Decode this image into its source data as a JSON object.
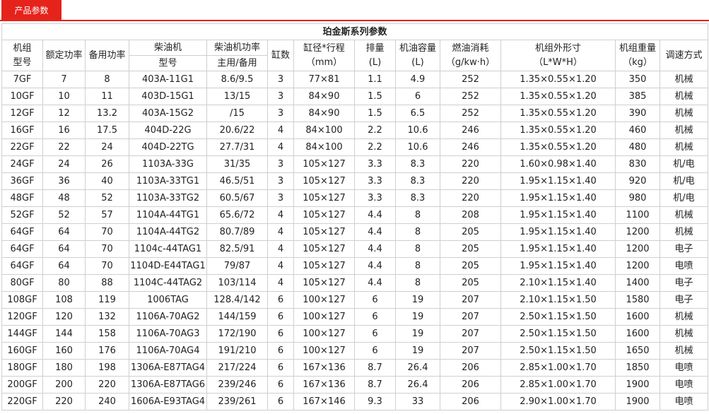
{
  "tab": {
    "label": "产品参数"
  },
  "table": {
    "title": "珀金斯系列参数",
    "headers": {
      "model_l1": "机组",
      "model_l2": "型号",
      "rated_power": "额定功率",
      "standby_power": "备用功率",
      "engine_l1": "柴油机",
      "engine_l2": "型号",
      "engine_power_l1": "柴油机功率",
      "engine_power_l2": "主用/备用",
      "cylinders": "缸数",
      "bore_l1": "缸径*行程",
      "bore_l2": "（mm）",
      "displacement_l1": "排量",
      "displacement_l2": "(L)",
      "oil_l1": "机油容量",
      "oil_l2": "(L)",
      "fuel_l1": "燃油消耗",
      "fuel_l2": "（g/kw·h）",
      "dims_l1": "机组外形寸",
      "dims_l2": "（L*W*H）",
      "weight_l1": "机组重量",
      "weight_l2": "（kg）",
      "governor": "调速方式"
    },
    "rows": [
      [
        "7GF",
        "7",
        "8",
        "403A-11G1",
        "8.6/9.5",
        "3",
        "77×81",
        "1.1",
        "4.9",
        "252",
        "1.35×0.55×1.20",
        "350",
        "机械"
      ],
      [
        "10GF",
        "10",
        "11",
        "403D-15G1",
        "13/15",
        "3",
        "84×90",
        "1.5",
        "6",
        "252",
        "1.35×0.55×1.20",
        "385",
        "机械"
      ],
      [
        "12GF",
        "12",
        "13.2",
        "403A-15G2",
        "/15",
        "3",
        "84×90",
        "1.5",
        "6.5",
        "252",
        "1.35×0.55×1.20",
        "390",
        "机械"
      ],
      [
        "16GF",
        "16",
        "17.5",
        "404D-22G",
        "20.6/22",
        "4",
        "84×100",
        "2.2",
        "10.6",
        "246",
        "1.35×0.55×1.20",
        "460",
        "机械"
      ],
      [
        "22GF",
        "22",
        "24",
        "404D-22TG",
        "27.7/31",
        "4",
        "84×100",
        "2.2",
        "10.6",
        "246",
        "1.35×0.55×1.20",
        "480",
        "机械"
      ],
      [
        "24GF",
        "24",
        "26",
        "1103A-33G",
        "31/35",
        "3",
        "105×127",
        "3.3",
        "8.3",
        "220",
        "1.60×0.98×1.40",
        "830",
        "机/电"
      ],
      [
        "36GF",
        "36",
        "40",
        "1103A-33TG1",
        "46.5/51",
        "3",
        "105×127",
        "3.3",
        "8.3",
        "220",
        "1.95×1.15×1.40",
        "920",
        "机/电"
      ],
      [
        "48GF",
        "48",
        "52",
        "1103A-33TG2",
        "60.5/67",
        "3",
        "105×127",
        "3.3",
        "8.3",
        "220",
        "1.95×1.15×1.40",
        "980",
        "机/电"
      ],
      [
        "52GF",
        "52",
        "57",
        "1104A-44TG1",
        "65.6/72",
        "4",
        "105×127",
        "4.4",
        "8",
        "208",
        "1.95×1.15×1.40",
        "1100",
        "机械"
      ],
      [
        "64GF",
        "64",
        "70",
        "1104A-44TG2",
        "80.7/89",
        "4",
        "105×127",
        "4.4",
        "8",
        "205",
        "1.95×1.15×1.40",
        "1200",
        "机械"
      ],
      [
        "64GF",
        "64",
        "70",
        "1104c-44TAG1",
        "82.5/91",
        "4",
        "105×127",
        "4.4",
        "8",
        "205",
        "1.95×1.15×1.40",
        "1200",
        "电子"
      ],
      [
        "64GF",
        "64",
        "70",
        "1104D-E44TAG1",
        "79/87",
        "4",
        "105×127",
        "4.4",
        "8",
        "205",
        "1.95×1.15×1.40",
        "1200",
        "电喷"
      ],
      [
        "80GF",
        "80",
        "88",
        "1104C-44TAG2",
        "103/114",
        "4",
        "105×127",
        "4.4",
        "8",
        "205",
        "2.10×1.15×1.40",
        "1400",
        "电子"
      ],
      [
        "108GF",
        "108",
        "119",
        "1006TAG",
        "128.4/142",
        "6",
        "100×127",
        "6",
        "19",
        "207",
        "2.10×1.15×1.50",
        "1580",
        "电子"
      ],
      [
        "120GF",
        "120",
        "132",
        "1106A-70AG2",
        "144/159",
        "6",
        "100×127",
        "6",
        "19",
        "207",
        "2.50×1.15×1.50",
        "1600",
        "机械"
      ],
      [
        "144GF",
        "144",
        "158",
        "1106A-70AG3",
        "172/190",
        "6",
        "100×127",
        "6",
        "19",
        "207",
        "2.50×1.15×1.50",
        "1600",
        "机械"
      ],
      [
        "160GF",
        "160",
        "176",
        "1106A-70AG4",
        "191/210",
        "6",
        "100×127",
        "6",
        "19",
        "207",
        "2.50×1.15×1.50",
        "1650",
        "机械"
      ],
      [
        "180GF",
        "180",
        "198",
        "1306A-E87TAG4",
        "217/224",
        "6",
        "167×136",
        "8.7",
        "26.4",
        "206",
        "2.85×1.00×1.70",
        "1850",
        "电喷"
      ],
      [
        "200GF",
        "200",
        "220",
        "1306A-E87TAG6",
        "239/246",
        "6",
        "167×136",
        "8.7",
        "26.4",
        "206",
        "2.85×1.00×1.70",
        "1900",
        "电喷"
      ],
      [
        "220GF",
        "220",
        "240",
        "1606A-E93TAG4",
        "239/261",
        "6",
        "167×146",
        "9.3",
        "33",
        "206",
        "2.90×1.00×1.70",
        "1900",
        "电喷"
      ]
    ]
  }
}
